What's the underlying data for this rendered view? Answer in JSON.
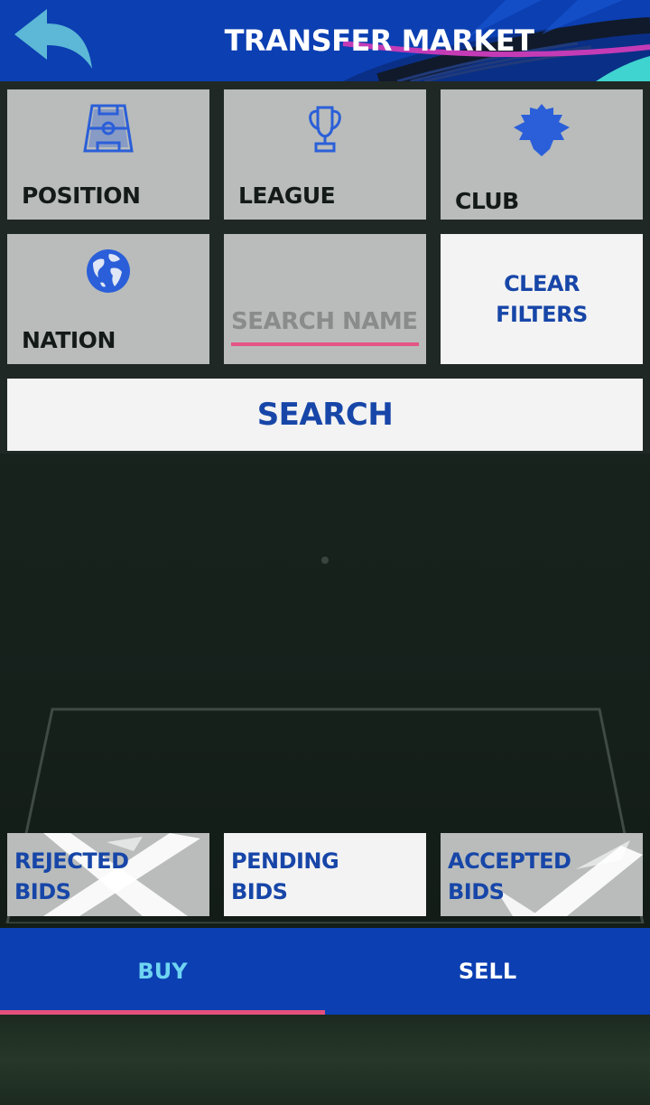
{
  "header": {
    "title": "TRANSFER MARKET",
    "back_icon": "back-arrow-icon"
  },
  "filters": {
    "position": {
      "label": "POSITION",
      "icon": "pitch-icon"
    },
    "league": {
      "label": "LEAGUE",
      "icon": "trophy-icon"
    },
    "club": {
      "label": "CLUB",
      "icon": "club-crest-icon"
    },
    "nation": {
      "label": "NATION",
      "icon": "globe-icon"
    },
    "search_name": {
      "placeholder": "SEARCH NAME",
      "value": ""
    },
    "clear": {
      "label": "CLEAR\nFILTERS"
    }
  },
  "search_button": {
    "label": "SEARCH"
  },
  "bids": {
    "rejected": {
      "label": "REJECTED\nBIDS"
    },
    "pending": {
      "label": "PENDING\nBIDS"
    },
    "accepted": {
      "label": "ACCEPTED\nBIDS"
    }
  },
  "tabs": [
    {
      "label": "BUY",
      "active": true
    },
    {
      "label": "SELL",
      "active": false
    }
  ],
  "colors": {
    "brand_blue": "#0b3fb2",
    "text_blue": "#1746a8",
    "accent_pink": "#e4507c",
    "active_tab": "#6fd4f1",
    "tile_grey": "#b9bcbb",
    "tile_light": "#f3f3f3"
  }
}
